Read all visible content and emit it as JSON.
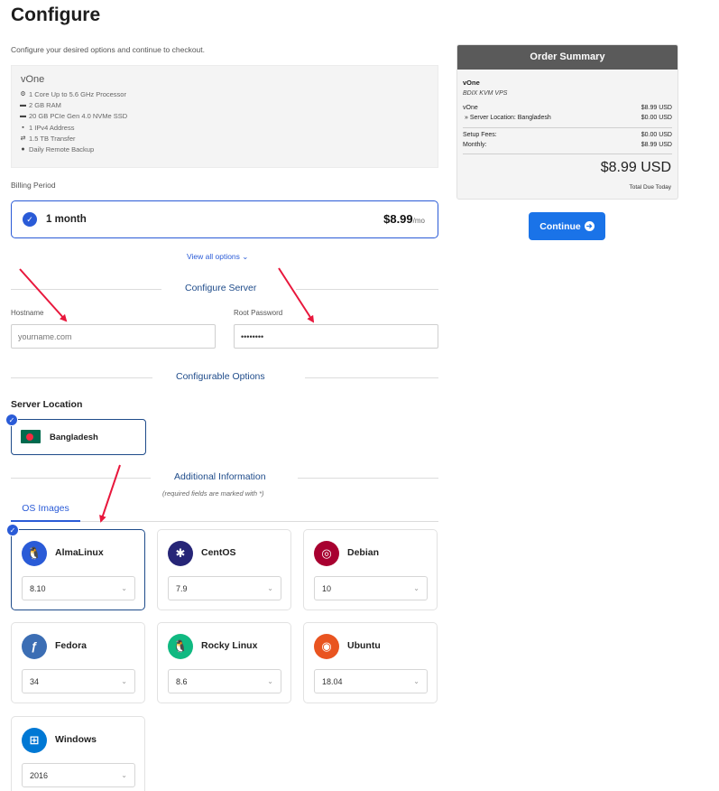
{
  "page": {
    "title": "Configure",
    "subtitle": "Configure your desired options and continue to checkout."
  },
  "product": {
    "name": "vOne",
    "features": [
      {
        "icon": "cpu-icon",
        "glyph": "⚙",
        "text": "1 Core Up to 5.6 GHz Processor"
      },
      {
        "icon": "ram-icon",
        "glyph": "▬",
        "text": "2 GB RAM"
      },
      {
        "icon": "disk-icon",
        "glyph": "▬",
        "text": "20 GB PCIe Gen 4.0 NVMe SSD"
      },
      {
        "icon": "network-icon",
        "glyph": "▪",
        "text": "1 IPv4 Address"
      },
      {
        "icon": "transfer-icon",
        "glyph": "⇄",
        "text": "1.5 TB Transfer"
      },
      {
        "icon": "backup-icon",
        "glyph": "●",
        "text": "Daily Remote Backup"
      }
    ]
  },
  "billing": {
    "label": "Billing Period",
    "option_name": "1 month",
    "price": "$8.99",
    "per": "/mo",
    "view_all": "View all options"
  },
  "configure_server": {
    "heading": "Configure Server",
    "hostname_label": "Hostname",
    "hostname_placeholder": "yourname.com",
    "password_label": "Root Password",
    "password_value": "••••••••"
  },
  "configurable_options": {
    "heading": "Configurable Options",
    "server_location_label": "Server Location",
    "location": "Bangladesh"
  },
  "additional_info": {
    "heading": "Additional Information",
    "note": "(required fields are marked with *)",
    "tab": "OS Images"
  },
  "os_images": [
    {
      "name": "AlmaLinux",
      "version": "8.10",
      "color": "#2a5bd7",
      "icon": "almalinux-icon",
      "glyph": "🐧"
    },
    {
      "name": "CentOS",
      "version": "7.9",
      "color": "#262577",
      "icon": "centos-icon",
      "glyph": "✱"
    },
    {
      "name": "Debian",
      "version": "10",
      "color": "#a80030",
      "icon": "debian-icon",
      "glyph": "◎"
    },
    {
      "name": "Fedora",
      "version": "34",
      "color": "#3c6eb4",
      "icon": "fedora-icon",
      "glyph": "ƒ"
    },
    {
      "name": "Rocky Linux",
      "version": "8.6",
      "color": "#10b981",
      "icon": "rockylinux-icon",
      "glyph": "🐧"
    },
    {
      "name": "Ubuntu",
      "version": "18.04",
      "color": "#e95420",
      "icon": "ubuntu-icon",
      "glyph": "◉"
    },
    {
      "name": "Windows",
      "version": "2016",
      "color": "#0078d4",
      "icon": "windows-icon",
      "glyph": "⊞"
    }
  ],
  "summary": {
    "heading": "Order Summary",
    "product": "vOne",
    "group": "BDIX KVM VPS",
    "line1_label": "vOne",
    "line1_value": "$8.99 USD",
    "line2_label": "» Server Location: Bangladesh",
    "line2_value": "$0.00 USD",
    "setup_label": "Setup Fees:",
    "setup_value": "$0.00 USD",
    "monthly_label": "Monthly:",
    "monthly_value": "$8.99 USD",
    "total": "$8.99 USD",
    "total_due": "Total Due Today"
  },
  "continue_label": "Continue",
  "colors": {
    "accent": "#2a5bd7",
    "button": "#1a73e8",
    "annotation_arrow": "#e8173c"
  }
}
